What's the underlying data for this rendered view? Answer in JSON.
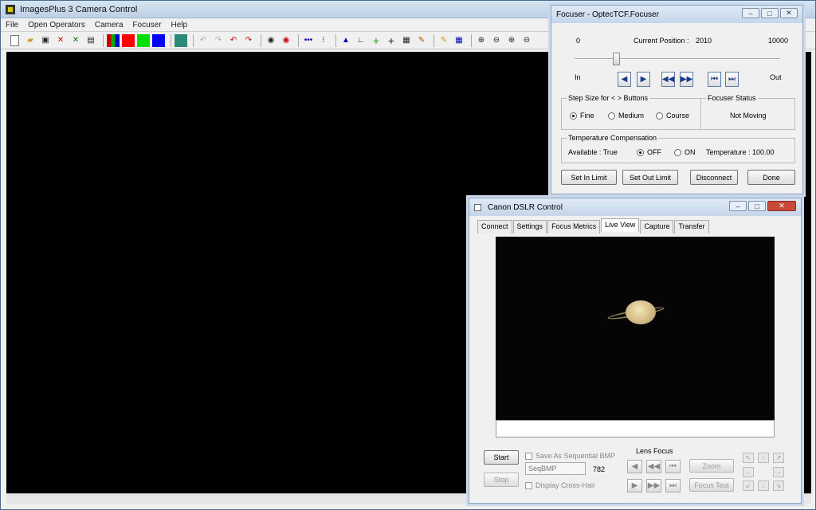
{
  "main": {
    "title": "ImagesPlus 3 Camera Control",
    "menu": [
      "File",
      "Open Operators",
      "Camera",
      "Focuser",
      "Help"
    ]
  },
  "focuser": {
    "title": "Focuser - OptecTCF.Focuser",
    "min": "0",
    "max": "10000",
    "position_label": "Current Position :",
    "position": "2010",
    "position_fraction": 0.201,
    "in_label": "In",
    "out_label": "Out",
    "step_group": "Step Size for < > Buttons",
    "step_options": [
      "Fine",
      "Medium",
      "Course"
    ],
    "step_selected": "Fine",
    "status_group": "Focuser Status",
    "status": "Not Moving",
    "temp_group": "Temperature Compensation",
    "available": "Available : True",
    "temp_off": "OFF",
    "temp_on": "ON",
    "temp_selected": "OFF",
    "temperature": "Temperature : 100.00",
    "buttons": {
      "set_in": "Set In Limit",
      "set_out": "Set Out Limit",
      "disconnect": "Disconnect",
      "done": "Done"
    }
  },
  "canon": {
    "title": "Canon DSLR Control",
    "tabs": [
      "Connect",
      "Settings",
      "Focus Metrics",
      "Live View",
      "Capture",
      "Transfer"
    ],
    "active_tab": "Live View",
    "start": "Start",
    "stop": "Stop",
    "save_seq": "Save As Sequential BMP",
    "seq_field": "SeqBMP",
    "seq_number": "782",
    "crosshair": "Display Cross-Hair",
    "lens_focus": "Lens Focus",
    "zoom": "Zoom",
    "focus_test": "Focus Test"
  },
  "icons": {
    "planet": "saturn-image"
  }
}
